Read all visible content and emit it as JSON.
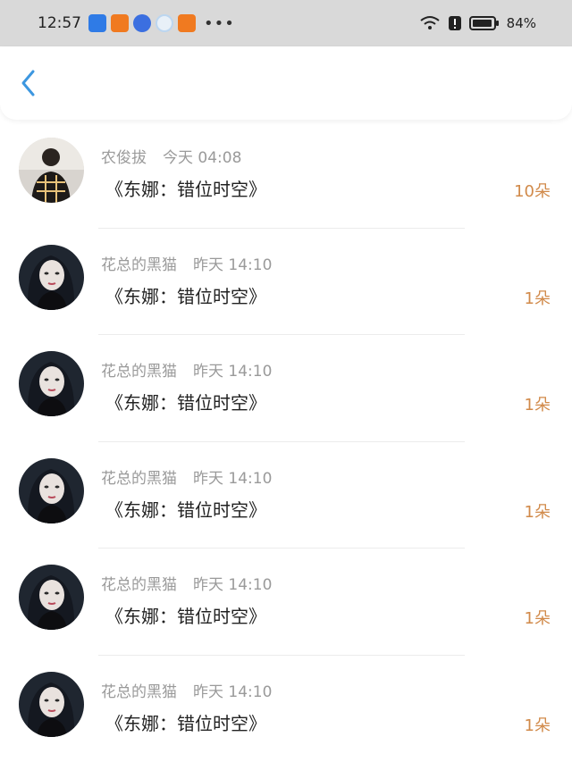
{
  "status_bar": {
    "time": "12:57",
    "battery": "84%",
    "app_icons": [
      {
        "name": "app-icon-1",
        "color": "#2f7be6"
      },
      {
        "name": "taobao-icon",
        "color": "#f07a20"
      },
      {
        "name": "shield-app-icon",
        "color": "#3b6fe0"
      },
      {
        "name": "circle-app-icon",
        "color": "#bcd6f0"
      },
      {
        "name": "taobao-icon",
        "color": "#f07a20"
      }
    ],
    "more": "•••"
  },
  "header": {
    "back_icon": "chevron-left-icon",
    "accent": "#3d97e0"
  },
  "records": [
    {
      "user": "农俊拔",
      "time": "今天 04:08",
      "title": "《东娜：错位时空》",
      "amount": "10朵",
      "avatar": "user-photo"
    },
    {
      "user": "花总的黑猫",
      "time": "昨天 14:10",
      "title": "《东娜：错位时空》",
      "amount": "1朵",
      "avatar": "anime-girl"
    },
    {
      "user": "花总的黑猫",
      "time": "昨天 14:10",
      "title": "《东娜：错位时空》",
      "amount": "1朵",
      "avatar": "anime-girl"
    },
    {
      "user": "花总的黑猫",
      "time": "昨天 14:10",
      "title": "《东娜：错位时空》",
      "amount": "1朵",
      "avatar": "anime-girl"
    },
    {
      "user": "花总的黑猫",
      "time": "昨天 14:10",
      "title": "《东娜：错位时空》",
      "amount": "1朵",
      "avatar": "anime-girl"
    },
    {
      "user": "花总的黑猫",
      "time": "昨天 14:10",
      "title": "《东娜：错位时空》",
      "amount": "1朵",
      "avatar": "anime-girl"
    }
  ],
  "colors": {
    "amount": "#d18a4a",
    "meta": "#9a9a9a",
    "status_bar_bg": "#d9d9d9"
  }
}
